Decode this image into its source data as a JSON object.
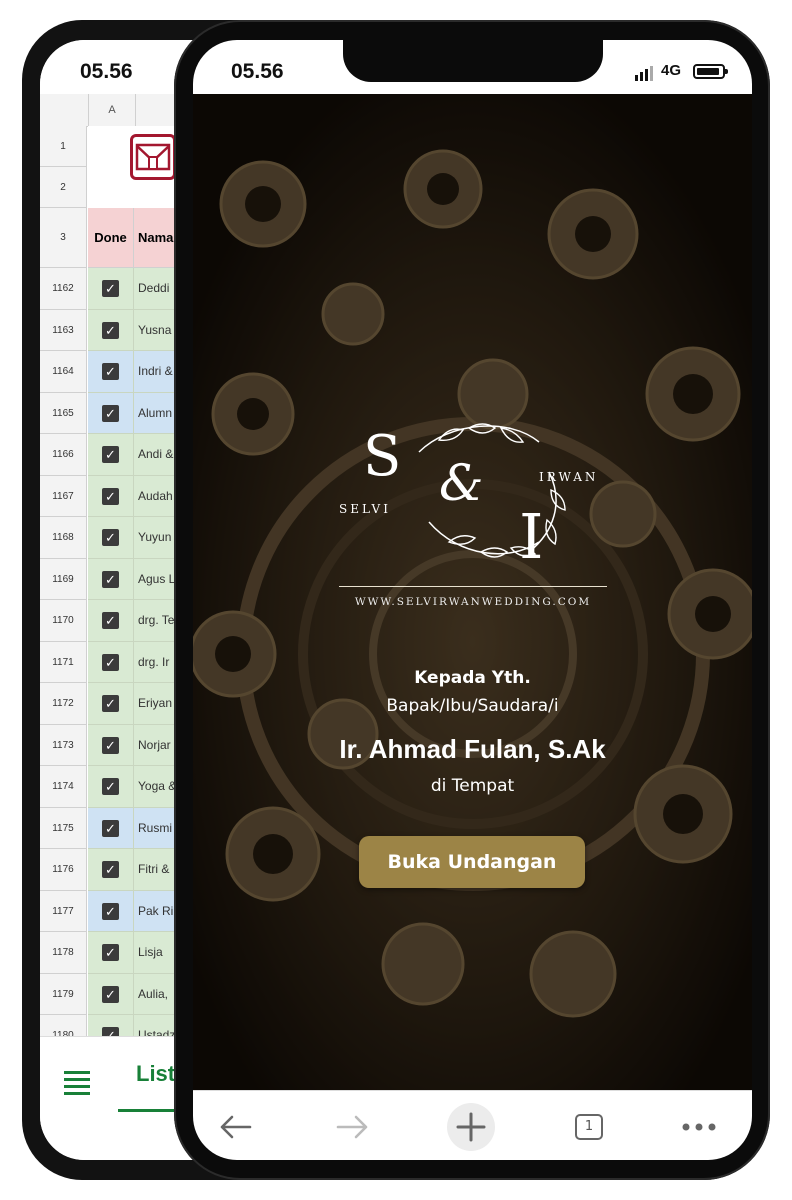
{
  "back_phone": {
    "status_time": "05.56",
    "sheet": {
      "column_header": "A",
      "header_rows": [
        "1",
        "2",
        "3"
      ],
      "columns": [
        "Done",
        "Nama"
      ],
      "rows": [
        {
          "num": "1162",
          "name": "Deddi",
          "checked": true,
          "color": "#d9ead3"
        },
        {
          "num": "1163",
          "name": "Yusna",
          "checked": true,
          "color": "#d9ead3"
        },
        {
          "num": "1164",
          "name": "Indri &",
          "checked": true,
          "color": "#cfe2f3"
        },
        {
          "num": "1165",
          "name": "Alumn",
          "checked": true,
          "color": "#cfe2f3"
        },
        {
          "num": "1166",
          "name": "Andi &",
          "checked": true,
          "color": "#d9ead3"
        },
        {
          "num": "1167",
          "name": "Audah",
          "checked": true,
          "color": "#d9ead3"
        },
        {
          "num": "1168",
          "name": "Yuyun",
          "checked": true,
          "color": "#d9ead3"
        },
        {
          "num": "1169",
          "name": "Agus L",
          "checked": true,
          "color": "#d9ead3"
        },
        {
          "num": "1170",
          "name": "drg. Te",
          "checked": true,
          "color": "#d9ead3"
        },
        {
          "num": "1171",
          "name": "drg. Ir",
          "checked": true,
          "color": "#d9ead3"
        },
        {
          "num": "1172",
          "name": "Eriyan",
          "checked": true,
          "color": "#d9ead3"
        },
        {
          "num": "1173",
          "name": "Norjar",
          "checked": true,
          "color": "#d9ead3"
        },
        {
          "num": "1174",
          "name": "Yoga &",
          "checked": true,
          "color": "#d9ead3"
        },
        {
          "num": "1175",
          "name": "Rusmi",
          "checked": true,
          "color": "#cfe2f3"
        },
        {
          "num": "1176",
          "name": "Fitri &",
          "checked": true,
          "color": "#d9ead3"
        },
        {
          "num": "1177",
          "name": "Pak Ri",
          "checked": true,
          "color": "#cfe2f3"
        },
        {
          "num": "1178",
          "name": "Lisja",
          "checked": true,
          "color": "#d9ead3"
        },
        {
          "num": "1179",
          "name": "Aulia,",
          "checked": true,
          "color": "#d9ead3"
        },
        {
          "num": "1180",
          "name": "Ustadz",
          "checked": true,
          "color": "#d9ead3"
        }
      ],
      "bottom_tab": "List"
    }
  },
  "front_phone": {
    "status_time": "05.56",
    "network": "4G",
    "monogram": {
      "letter_left": "S",
      "letter_right": "I",
      "ampersand": "&",
      "name_left": "SELVI",
      "name_right": "IRWAN",
      "url": "WWW.SELVIRWANWEDDING.COM"
    },
    "invite": {
      "to_label": "Kepada Yth.",
      "salutation": "Bapak/Ibu/Saudara/i",
      "guest_name": "Ir. Ahmad Fulan, S.Ak",
      "place": "di Tempat",
      "open_button": "Buka Undangan"
    },
    "browser": {
      "tab_count": "1"
    }
  },
  "colors": {
    "accent_gold": "#9c8446",
    "sheet_green": "#188038",
    "header_pink": "#f5d2d3"
  }
}
